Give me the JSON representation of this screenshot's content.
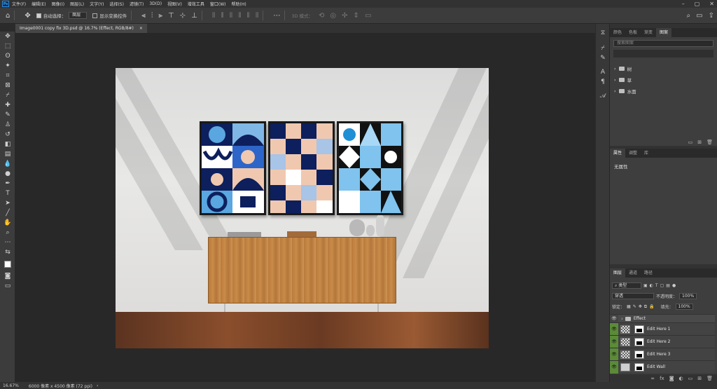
{
  "app": {
    "logo": "Ps"
  },
  "menu": [
    "文件(F)",
    "编辑(E)",
    "图像(I)",
    "图层(L)",
    "文字(Y)",
    "选择(S)",
    "滤镜(T)",
    "3D(D)",
    "视图(V)",
    "增效工具",
    "窗口(W)",
    "帮助(H)"
  ],
  "options": {
    "auto_select_label": "自动选择：",
    "auto_select_value": "图层",
    "show_transform_label": "显示变换控件",
    "mode_3d_label": "3D 模式："
  },
  "document": {
    "tab_title": "Image0001 copy fix 3D.psd @ 16.7% (Effect, RGB/8#)",
    "close": "×"
  },
  "status": {
    "zoom": "16.67%",
    "size": "6000 像素 x 4500 像素 (72 ppi)"
  },
  "panels": {
    "top_tabs": [
      "颜色",
      "色板",
      "渐变",
      "图案"
    ],
    "library_search_placeholder": "搜索图案",
    "folders": [
      "树",
      "草",
      "水面"
    ],
    "props_tabs": [
      "属性",
      "调整",
      "库"
    ],
    "props_empty": "无属性",
    "layer_tabs": [
      "图层",
      "通道",
      "路径"
    ],
    "kind_label": "类型",
    "blend_mode": "穿透",
    "opacity_label": "不透明度：",
    "opacity_value": "100%",
    "lock_label": "锁定：",
    "fill_label": "填充：",
    "fill_value": "100%",
    "layers": [
      {
        "name": "Effect",
        "type": "group"
      },
      {
        "name": "Edit Here 1",
        "type": "smart"
      },
      {
        "name": "Edit Here 2",
        "type": "smart"
      },
      {
        "name": "Edit Here 3",
        "type": "smart"
      },
      {
        "name": "Edit Wall",
        "type": "smart"
      }
    ]
  },
  "colors": {
    "accent_eye": "#5b8a38",
    "panel_bg": "#323232"
  }
}
